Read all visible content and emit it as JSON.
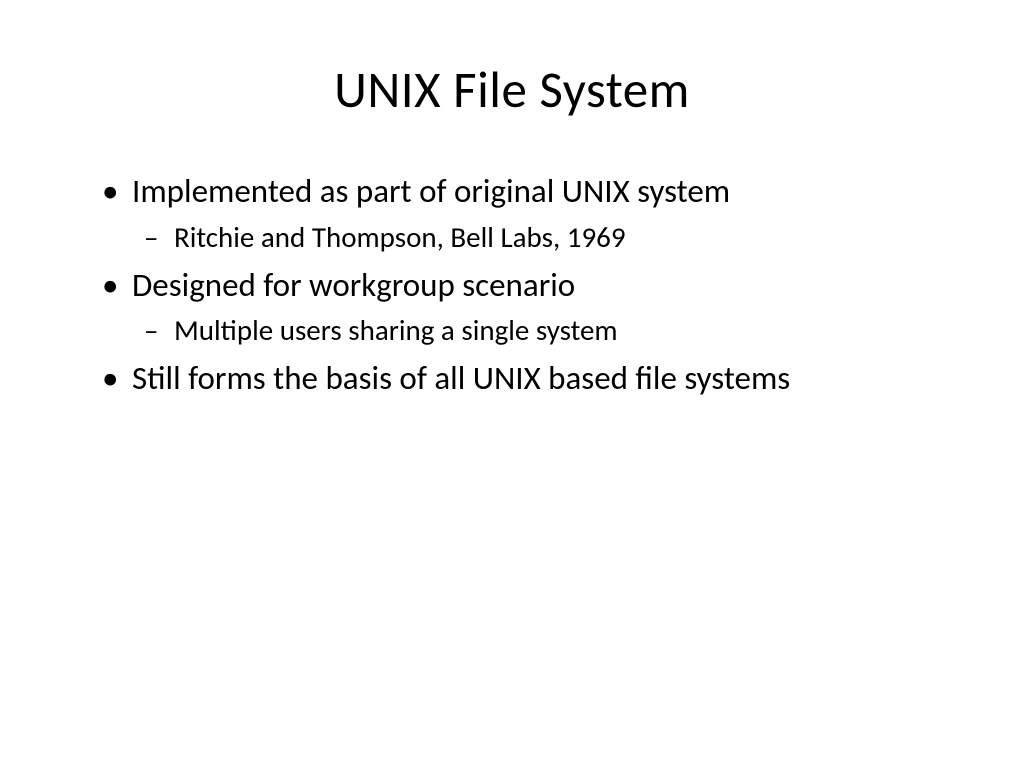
{
  "slide": {
    "title": "UNIX File System",
    "bullets": [
      {
        "text": "Implemented as part of original UNIX system",
        "sub": [
          "Ritchie and Thompson, Bell Labs, 1969"
        ]
      },
      {
        "text": "Designed for workgroup scenario",
        "sub": [
          "Multiple users sharing a single system"
        ]
      },
      {
        "text": "Still forms the basis of all UNIX based file systems",
        "sub": []
      }
    ]
  }
}
